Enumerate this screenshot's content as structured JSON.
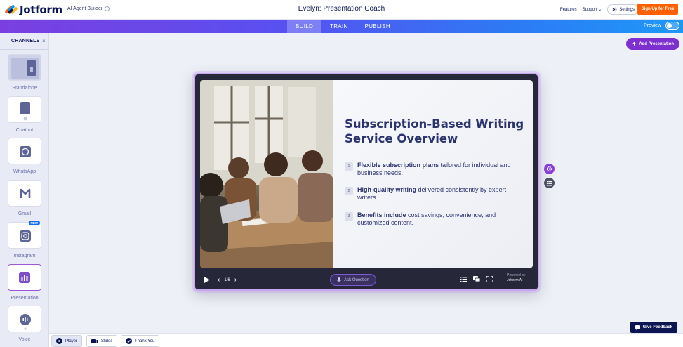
{
  "header": {
    "brand": "Jotform",
    "builder_label": "AI Agent Builder",
    "title": "Evelyn: Presentation Coach",
    "nav": {
      "features": "Features",
      "support": "Support",
      "settings": "Settings"
    },
    "signup_label": "Sign Up for Free"
  },
  "tabs": [
    {
      "label": "BUILD",
      "active": true
    },
    {
      "label": "TRAIN",
      "active": false
    },
    {
      "label": "PUBLISH",
      "active": false
    }
  ],
  "preview": {
    "label": "Preview",
    "enabled": false
  },
  "sidebar": {
    "title": "CHANNELS",
    "channels": [
      {
        "label": "Standalone",
        "icon": "standalone-icon"
      },
      {
        "label": "Chatbot",
        "icon": "chatbot-icon"
      },
      {
        "label": "WhatsApp",
        "icon": "whatsapp-icon"
      },
      {
        "label": "Gmail",
        "icon": "gmail-icon"
      },
      {
        "label": "Instagram",
        "icon": "instagram-icon",
        "badge": "NEW"
      },
      {
        "label": "Presentation",
        "icon": "presentation-icon",
        "selected": true
      },
      {
        "label": "Voice",
        "icon": "voice-icon"
      }
    ]
  },
  "main": {
    "add_presentation_label": "Add Presentation",
    "slide": {
      "heading": "Subscription-Based Writing Service Overview",
      "bullets": [
        {
          "num": "1",
          "bold": "Flexible subscription plans",
          "rest": " tailored for individual and business needs."
        },
        {
          "num": "2",
          "bold": "High-quality writing",
          "rest": " delivered consistently by expert writers."
        },
        {
          "num": "3",
          "bold": "Benefits include",
          "rest": " cost savings, convenience, and customized content."
        }
      ]
    },
    "player": {
      "page": "1/6",
      "ask_label": "Ask Question",
      "powered_by": "Powered by",
      "powered_brand": "Jotform AI"
    }
  },
  "bottom": {
    "tabs": [
      {
        "label": "Player",
        "active": true
      },
      {
        "label": "Slides",
        "active": false
      },
      {
        "label": "Thank You",
        "active": false
      }
    ],
    "feedback_label": "Give Feedback"
  },
  "colors": {
    "brand_navy": "#0a1551",
    "accent_purple": "#7d2fd0",
    "signup_orange": "#ff6100",
    "tab_gradient_start": "#7b3fe0",
    "tab_gradient_end": "#1e98f7"
  }
}
